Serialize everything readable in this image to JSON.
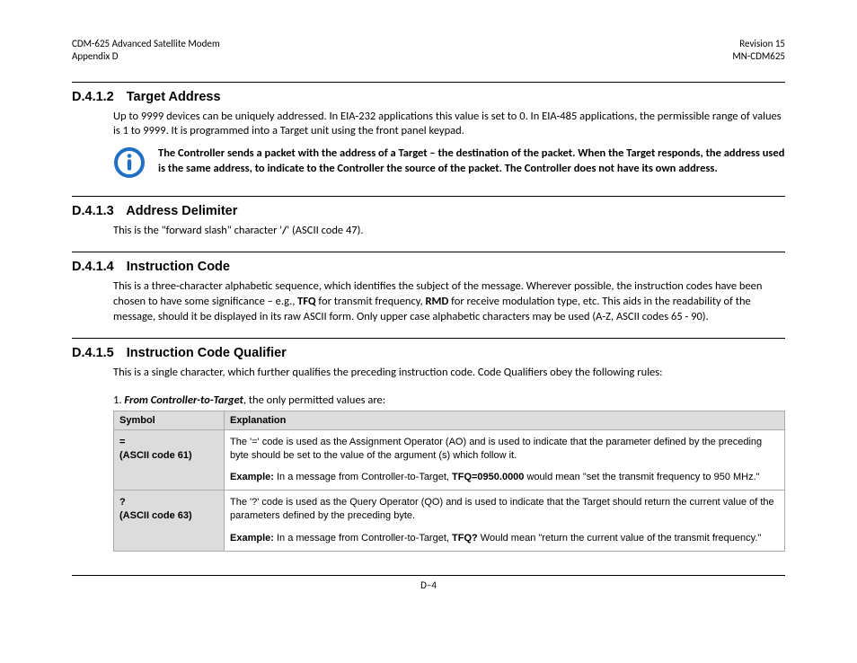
{
  "header": {
    "left_line1": "CDM-625 Advanced Satellite Modem",
    "left_line2": "Appendix D",
    "right_line1": "Revision 15",
    "right_line2": "MN-CDM625"
  },
  "sections": {
    "s412": {
      "num": "D.4.1.2",
      "title": "Target Address",
      "para": "Up to 9999 devices can be uniquely addressed. In EIA-232 applications this value is set to 0. In EIA-485 applications, the permissible range of values is 1 to 9999. It is programmed into a Target unit using the front panel keypad.",
      "note": "The Controller sends a packet with the address of a Target – the destination of the packet. When the Target responds, the address used is the same address, to indicate to the Controller the source of the packet. The Controller does not have its own address."
    },
    "s413": {
      "num": "D.4.1.3",
      "title": "Address Delimiter",
      "para_pre": "This is the \"forward slash\" character '",
      "para_slash": "/",
      "para_post": "' (ASCII code 47)."
    },
    "s414": {
      "num": "D.4.1.4",
      "title": "Instruction Code",
      "para_a": "This is a three-character alphabetic sequence, which identifies the subject of the message. Wherever possible, the instruction codes have been chosen to have some significance – e.g., ",
      "tfq": "TFQ",
      "para_b": " for transmit frequency, ",
      "rmd": "RMD",
      "para_c": " for receive modulation type, etc. This aids in the readability of the message, should it be displayed in its raw ASCII form. Only upper case alphabetic characters may be used (A-Z, ASCII codes 65 - 90)."
    },
    "s415": {
      "num": "D.4.1.5",
      "title": "Instruction Code Qualifier",
      "intro": "This is a single character, which further qualifies the preceding instruction code. Code Qualifiers obey the following rules:",
      "list_lead_num": "1.   ",
      "list_lead_em": "From Controller-to-Target",
      "list_lead_tail": ", the only permitted values are:",
      "table": {
        "head_symbol": "Symbol",
        "head_explanation": "Explanation",
        "rows": [
          {
            "sym_char": "=",
            "sym_ascii": "(ASCII code 61)",
            "desc": "The '=' code is used as the Assignment Operator (AO) and is used to indicate that the parameter defined by the preceding byte should be set to the value of the argument (s) which follow it.",
            "example_label": "Example:",
            "example_a": " In a message from Controller-to-Target, ",
            "example_code": "TFQ=0950.0000",
            "example_b": " would mean \"set the transmit frequency to 950 MHz.\""
          },
          {
            "sym_char": "?",
            "sym_ascii": "(ASCII code 63)",
            "desc": "The '?' code is used as the Query Operator (QO) and is used to indicate that the Target should return the current value of the parameters defined by the preceding byte.",
            "example_label": "Example:",
            "example_a": " In a message from Controller-to-Target, ",
            "example_code": "TFQ?",
            "example_b": " Would mean \"return the current value of the transmit frequency.\""
          }
        ]
      }
    }
  },
  "footer": {
    "page": "D–4"
  }
}
